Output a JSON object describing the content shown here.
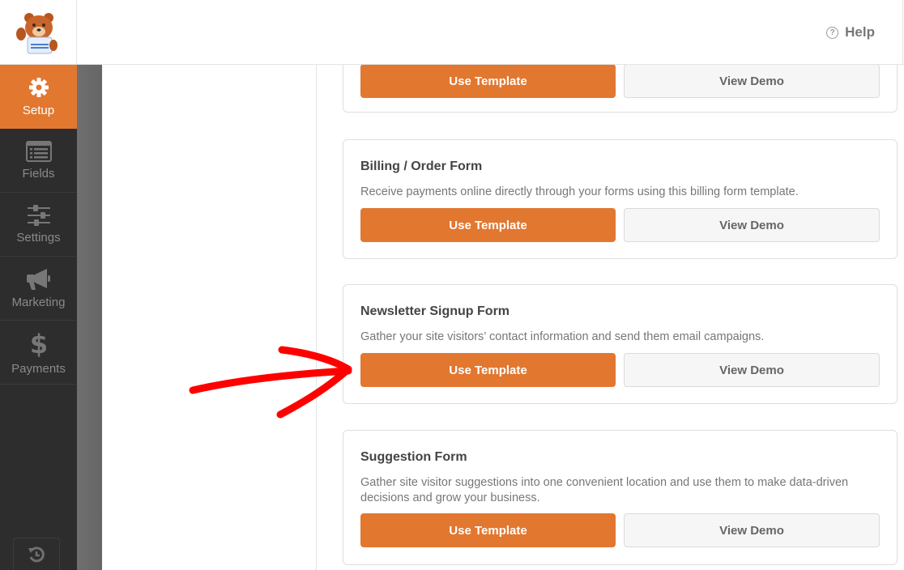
{
  "header": {
    "help_label": "Help",
    "help_icon": "question-circle-icon",
    "logo": "wpforms-bear-mascot"
  },
  "sidebar": {
    "items": [
      {
        "label": "Setup",
        "icon": "gear-icon",
        "active": true
      },
      {
        "label": "Fields",
        "icon": "list-form-icon",
        "active": false
      },
      {
        "label": "Settings",
        "icon": "sliders-icon",
        "active": false
      },
      {
        "label": "Marketing",
        "icon": "megaphone-icon",
        "active": false
      },
      {
        "label": "Payments",
        "icon": "dollar-icon",
        "active": false
      }
    ],
    "revisions_icon": "history-icon"
  },
  "templates": [
    {
      "title": "",
      "description": "",
      "use_label": "Use Template",
      "demo_label": "View Demo"
    },
    {
      "title": "Billing / Order Form",
      "description": "Receive payments online directly through your forms using this billing form template.",
      "use_label": "Use Template",
      "demo_label": "View Demo"
    },
    {
      "title": "Newsletter Signup Form",
      "description": "Gather your site visitors’ contact information and send them email campaigns.",
      "use_label": "Use Template",
      "demo_label": "View Demo"
    },
    {
      "title": "Suggestion Form",
      "description": "Gather site visitor suggestions into one convenient location and use them to make data-driven decisions and grow your business.",
      "use_label": "Use Template",
      "demo_label": "View Demo"
    }
  ],
  "annotation": {
    "type": "red-arrow",
    "points_to": "Newsletter Signup Form - Use Template",
    "color": "#ff0000"
  },
  "colors": {
    "accent": "#e27730",
    "sidebar_bg": "#2d2d2d",
    "sidebar_text": "#8a8a8a"
  }
}
